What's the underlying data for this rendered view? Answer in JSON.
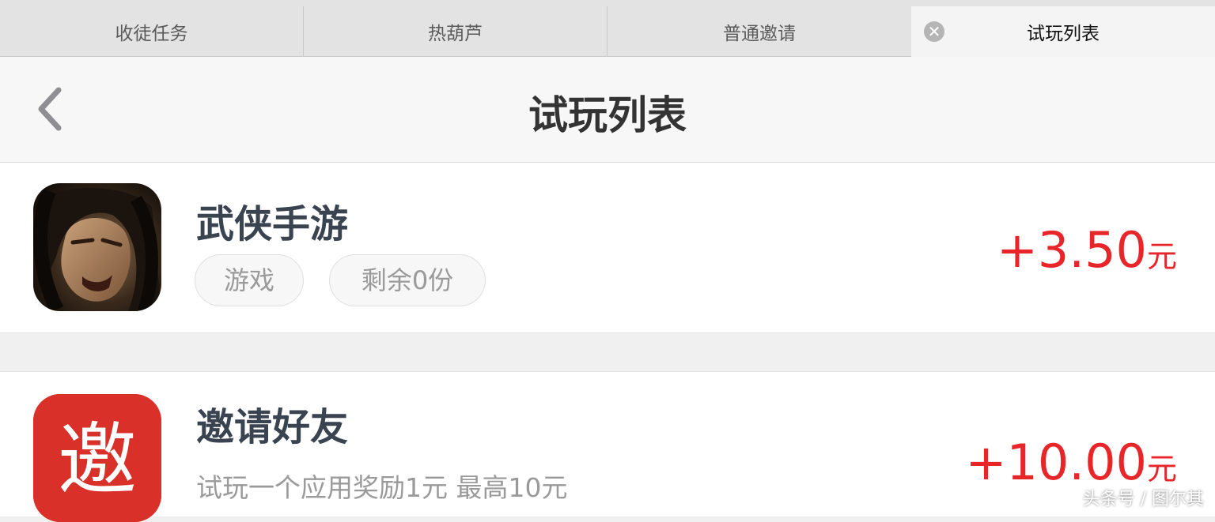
{
  "tabs": [
    {
      "label": "收徒任务"
    },
    {
      "label": "热葫芦"
    },
    {
      "label": "普通邀请"
    },
    {
      "label": "试玩列表",
      "active": true
    }
  ],
  "tab_close_glyph": "✕",
  "navbar": {
    "title": "试玩列表",
    "back_icon": "chevron-left-icon"
  },
  "items": [
    {
      "title": "武侠手游",
      "icon": "warrior-game-icon",
      "tags": [
        "游戏",
        "剩余0份"
      ],
      "reward": {
        "amount": "+3.50",
        "unit": "元"
      }
    },
    {
      "title": "邀请好友",
      "icon": "invite-icon",
      "icon_text": "邀",
      "icon_color": "#d9302a",
      "description": "试玩一个应用奖励1元 最高10元",
      "reward": {
        "amount": "+10.00",
        "unit": "元"
      }
    }
  ],
  "reward_color": "#e8262a",
  "watermark": "头条号 / 图尔其"
}
